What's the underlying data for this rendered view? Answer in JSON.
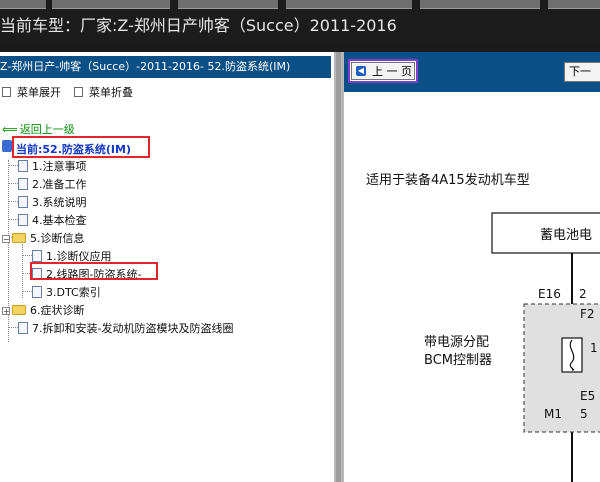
{
  "header": {
    "title": "当前车型：厂家:Z-郑州日产帅客（Succe）2011-2016"
  },
  "left_panel": {
    "head_title": "Z-郑州日产-帅客（Succe）-2011-2016- 52.防盗系统(IM)",
    "expand_label": "菜单展开",
    "collapse_label": "菜单折叠",
    "back_label": "返回上一级",
    "current_label": "当前:52.防盗系统(IM)",
    "items": [
      {
        "label": "1.注意事项"
      },
      {
        "label": "2.准备工作"
      },
      {
        "label": "3.系统说明"
      },
      {
        "label": "4.基本检查"
      },
      {
        "label": "5.诊断信息"
      },
      {
        "label": "1.诊断仪应用"
      },
      {
        "label": "2.线路图-防盗系统-"
      },
      {
        "label": "3.DTC索引"
      },
      {
        "label": "6.症状诊断"
      },
      {
        "label": "7.拆卸和安装-发动机防盗模块及防盗线圈"
      }
    ]
  },
  "right_panel": {
    "prev_label": "上 一 页",
    "next_label": "下一",
    "diagram": {
      "applies_to": "适用于装备4A15发动机车型",
      "battery_label": "蓄电池电",
      "bcm_label_1": "带电源分配",
      "bcm_label_2": "BCM控制器",
      "e16": "E16",
      "e16_pin": "2",
      "f2": "F2",
      "pin_1": "1",
      "e5": "E5",
      "m1": "M1",
      "m1_pin": "5"
    }
  }
}
